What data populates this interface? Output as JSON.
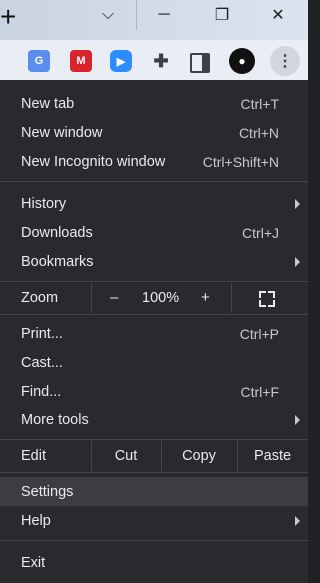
{
  "window": {
    "new_tab_glyph": "+",
    "controls": {
      "tab_search": "⌵",
      "minimize": "─",
      "restore": "❐",
      "close": "✕"
    }
  },
  "toolbar": {
    "extensions": [
      {
        "name": "google-translate-icon",
        "glyph": "G"
      },
      {
        "name": "mendeley-icon",
        "glyph": "M"
      },
      {
        "name": "zoom-icon",
        "glyph": "▶"
      },
      {
        "name": "puzzle-icon",
        "glyph": "✚"
      }
    ],
    "avatar_glyph": "●",
    "more_glyph": "⋮"
  },
  "menu": {
    "new_tab": {
      "label": "New tab",
      "shortcut": "Ctrl+T"
    },
    "new_window": {
      "label": "New window",
      "shortcut": "Ctrl+N"
    },
    "new_incognito": {
      "label": "New Incognito window",
      "shortcut": "Ctrl+Shift+N"
    },
    "history": {
      "label": "History"
    },
    "downloads": {
      "label": "Downloads",
      "shortcut": "Ctrl+J"
    },
    "bookmarks": {
      "label": "Bookmarks"
    },
    "zoom": {
      "label": "Zoom",
      "minus": "–",
      "value": "100%",
      "plus": "+"
    },
    "print": {
      "label": "Print...",
      "shortcut": "Ctrl+P"
    },
    "cast": {
      "label": "Cast..."
    },
    "find": {
      "label": "Find...",
      "shortcut": "Ctrl+F"
    },
    "more_tools": {
      "label": "More tools"
    },
    "edit": {
      "label": "Edit",
      "cut": "Cut",
      "copy": "Copy",
      "paste": "Paste"
    },
    "settings": {
      "label": "Settings"
    },
    "help": {
      "label": "Help"
    },
    "exit": {
      "label": "Exit"
    }
  },
  "colors": {
    "menu_bg": "#292a2d",
    "highlight": "#3c3d40",
    "text": "#e8eaed",
    "shortcut": "#c7c9cc"
  }
}
